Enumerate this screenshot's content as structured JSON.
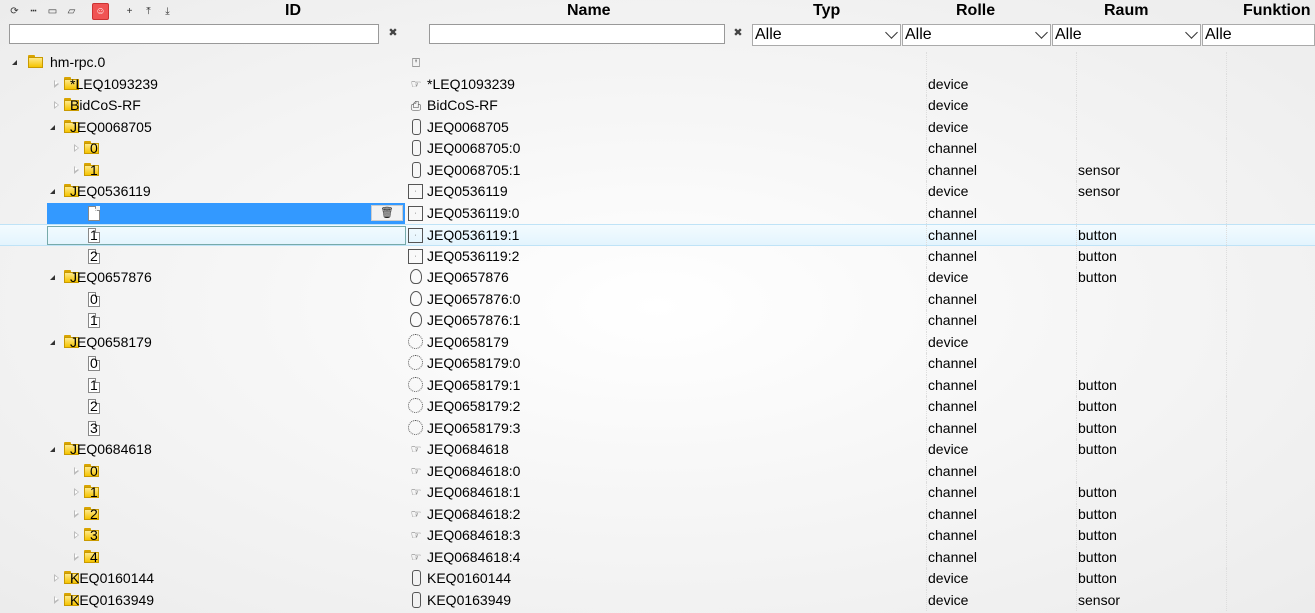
{
  "toolbar": {
    "buttons": [
      {
        "name": "refresh-icon",
        "glyph": "⟳"
      },
      {
        "name": "list-view-icon",
        "glyph": "┅"
      },
      {
        "name": "folder-collapse-icon",
        "glyph": "▭"
      },
      {
        "name": "folder-expand-icon",
        "glyph": "▱"
      }
    ],
    "red_button": {
      "name": "user-icon",
      "glyph": "☺"
    },
    "right_buttons": [
      {
        "name": "add-icon",
        "glyph": "+"
      },
      {
        "name": "upload-icon",
        "glyph": "⤒"
      },
      {
        "name": "download-icon",
        "glyph": "⤓"
      }
    ]
  },
  "columns": {
    "id": "ID",
    "name": "Name",
    "typ": "Typ",
    "rolle": "Rolle",
    "raum": "Raum",
    "funktion": "Funktion"
  },
  "filters": {
    "id_value": "",
    "name_value": "",
    "typ": "Alle",
    "rolle": "Alle",
    "raum": "Alle",
    "funktion": "Alle",
    "clear_glyph": "✖"
  },
  "rows": [
    {
      "level": 0,
      "exp": "open",
      "kind": "folder",
      "id": "hm-rpc.0",
      "icon": "adapter",
      "name": "",
      "rolle": "",
      "raum": ""
    },
    {
      "level": 1,
      "exp": "closed",
      "kind": "folder",
      "id": "*LEQ1093239",
      "icon": "hand",
      "name": "*LEQ1093239",
      "rolle": "device",
      "raum": ""
    },
    {
      "level": 1,
      "exp": "closed",
      "kind": "folder",
      "id": "BidCoS-RF",
      "icon": "lock",
      "name": "BidCoS-RF",
      "rolle": "device",
      "raum": ""
    },
    {
      "level": 1,
      "exp": "open",
      "kind": "folder",
      "id": "JEQ0068705",
      "icon": "rocker",
      "name": "JEQ0068705",
      "rolle": "device",
      "raum": ""
    },
    {
      "level": 2,
      "exp": "closed",
      "kind": "folder",
      "id": "0",
      "icon": "rocker",
      "name": "JEQ0068705:0",
      "rolle": "channel",
      "raum": ""
    },
    {
      "level": 2,
      "exp": "closed",
      "kind": "folder",
      "id": "1",
      "icon": "rocker",
      "name": "JEQ0068705:1",
      "rolle": "channel",
      "raum": "sensor"
    },
    {
      "level": 1,
      "exp": "open",
      "kind": "folder",
      "id": "JEQ0536119",
      "icon": "box",
      "name": "JEQ0536119",
      "rolle": "device",
      "raum": "sensor"
    },
    {
      "level": 2,
      "exp": "none",
      "kind": "file",
      "id": "0",
      "icon": "box",
      "name": "JEQ0536119:0",
      "rolle": "channel",
      "raum": "",
      "state": "selected"
    },
    {
      "level": 2,
      "exp": "none",
      "kind": "file",
      "id": "1",
      "icon": "box",
      "name": "JEQ0536119:1",
      "rolle": "channel",
      "raum": "button",
      "state": "hover"
    },
    {
      "level": 2,
      "exp": "none",
      "kind": "file",
      "id": "2",
      "icon": "box",
      "name": "JEQ0536119:2",
      "rolle": "channel",
      "raum": "button"
    },
    {
      "level": 1,
      "exp": "open",
      "kind": "folder",
      "id": "JEQ0657876",
      "icon": "knob",
      "name": "JEQ0657876",
      "rolle": "device",
      "raum": "button"
    },
    {
      "level": 2,
      "exp": "none",
      "kind": "file",
      "id": "0",
      "icon": "knob",
      "name": "JEQ0657876:0",
      "rolle": "channel",
      "raum": ""
    },
    {
      "level": 2,
      "exp": "none",
      "kind": "file",
      "id": "1",
      "icon": "knob",
      "name": "JEQ0657876:1",
      "rolle": "channel",
      "raum": ""
    },
    {
      "level": 1,
      "exp": "open",
      "kind": "folder",
      "id": "JEQ0658179",
      "icon": "ring",
      "name": "JEQ0658179",
      "rolle": "device",
      "raum": ""
    },
    {
      "level": 2,
      "exp": "none",
      "kind": "file",
      "id": "0",
      "icon": "ring",
      "name": "JEQ0658179:0",
      "rolle": "channel",
      "raum": ""
    },
    {
      "level": 2,
      "exp": "none",
      "kind": "file",
      "id": "1",
      "icon": "ring",
      "name": "JEQ0658179:1",
      "rolle": "channel",
      "raum": "button"
    },
    {
      "level": 2,
      "exp": "none",
      "kind": "file",
      "id": "2",
      "icon": "ring",
      "name": "JEQ0658179:2",
      "rolle": "channel",
      "raum": "button"
    },
    {
      "level": 2,
      "exp": "none",
      "kind": "file",
      "id": "3",
      "icon": "ring",
      "name": "JEQ0658179:3",
      "rolle": "channel",
      "raum": "button"
    },
    {
      "level": 1,
      "exp": "open",
      "kind": "folder",
      "id": "JEQ0684618",
      "icon": "hand",
      "name": "JEQ0684618",
      "rolle": "device",
      "raum": "button"
    },
    {
      "level": 2,
      "exp": "closed",
      "kind": "folder",
      "id": "0",
      "icon": "hand",
      "name": "JEQ0684618:0",
      "rolle": "channel",
      "raum": ""
    },
    {
      "level": 2,
      "exp": "closed",
      "kind": "folder",
      "id": "1",
      "icon": "hand",
      "name": "JEQ0684618:1",
      "rolle": "channel",
      "raum": "button"
    },
    {
      "level": 2,
      "exp": "closed",
      "kind": "folder",
      "id": "2",
      "icon": "hand",
      "name": "JEQ0684618:2",
      "rolle": "channel",
      "raum": "button"
    },
    {
      "level": 2,
      "exp": "closed",
      "kind": "folder",
      "id": "3",
      "icon": "hand",
      "name": "JEQ0684618:3",
      "rolle": "channel",
      "raum": "button"
    },
    {
      "level": 2,
      "exp": "closed",
      "kind": "folder",
      "id": "4",
      "icon": "hand",
      "name": "JEQ0684618:4",
      "rolle": "channel",
      "raum": "button"
    },
    {
      "level": 1,
      "exp": "closed",
      "kind": "folder",
      "id": "KEQ0160144",
      "icon": "rocker",
      "name": "KEQ0160144",
      "rolle": "device",
      "raum": "button"
    },
    {
      "level": 1,
      "exp": "closed",
      "kind": "folder",
      "id": "KEQ0163949",
      "icon": "rocker",
      "name": "KEQ0163949",
      "rolle": "device",
      "raum": "sensor"
    }
  ],
  "row_action": {
    "name": "delete-icon",
    "glyph": "🗑"
  }
}
